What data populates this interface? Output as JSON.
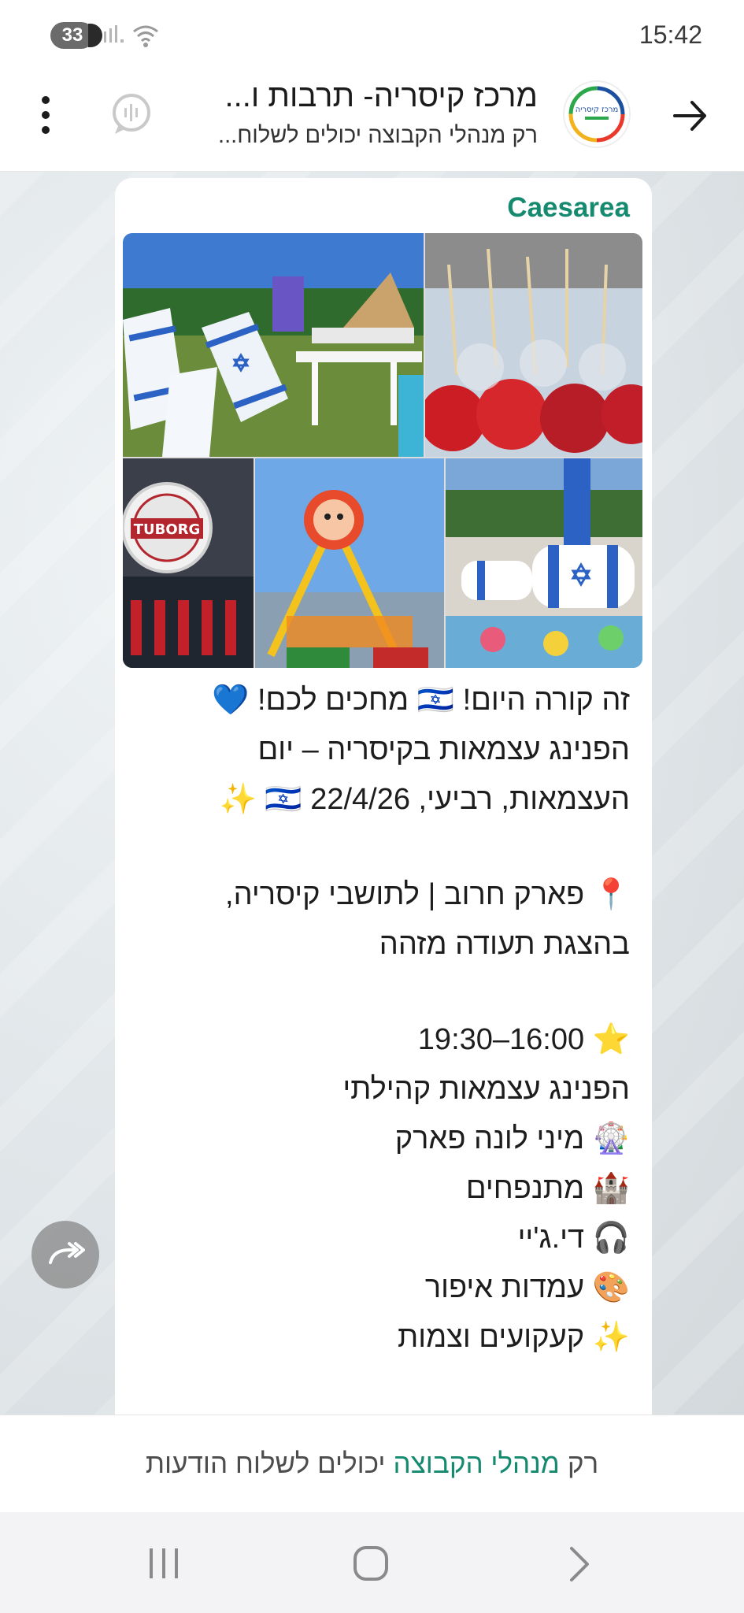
{
  "status_bar": {
    "battery": "33",
    "time": "15:42"
  },
  "header": {
    "title": "מרכז קיסריה- תרבות ו...",
    "subtitle": "רק מנהלי הקבוצה יכולים לשלוח...",
    "avatar_logo_text": "מרכז קיסריה"
  },
  "message": {
    "sender": "Caesarea",
    "photo_labels": {
      "tuborg": "TUBORG"
    },
    "lines": [
      "זה קורה היום! 🇮🇱 מחכים לכם! 💙",
      "הפנינג עצמאות בקיסריה – יום",
      "העצמאות, רביעי, 22/4/26 🇮🇱 ✨",
      "",
      "📍 פארק חרוב | לתושבי קיסריה,",
      "בהצגת תעודה מזהה",
      "",
      "⭐ 16:00–19:30",
      "הפנינג עצמאות קהילתי",
      "🎡 מיני לונה פארק",
      "🏰 מתנפחים",
      "🎧 די.ג'יי",
      "🎨 עמדות איפור",
      "✨ קעקועים וצמות"
    ]
  },
  "notice": {
    "prefix": "רק",
    "highlight": "מנהלי הקבוצה",
    "suffix": "יכולים לשלוח הודעות"
  },
  "colors": {
    "accent_green": "#168a6f",
    "chat_bg": "#dfe5e8",
    "bubble_bg": "#ffffff"
  },
  "icons": {
    "back": "arrow-right-icon",
    "menu": "more-vertical-icon",
    "voice_chat": "voice-chat-icon",
    "forward": "forward-icon"
  }
}
